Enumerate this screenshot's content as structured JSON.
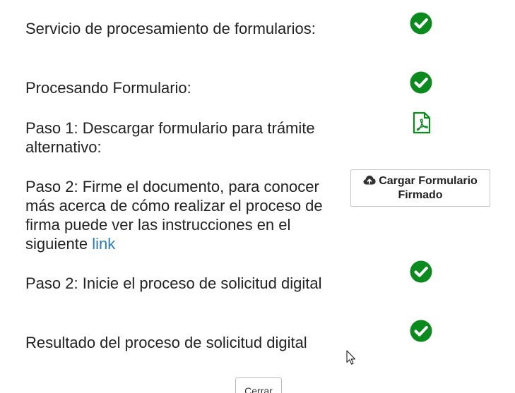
{
  "steps": [
    {
      "label": "Servicio de procesamiento de formularios:",
      "status_icon": "check-circle-icon"
    },
    {
      "label": "Procesando Formulario:",
      "status_icon": "check-circle-icon"
    },
    {
      "label": "Paso 1: Descargar formulario para trámite alternativo:",
      "status_icon": "pdf-file-icon"
    },
    {
      "label_prefix": "Paso 2: Firme el documento, para conocer más acerca de cómo realizar el proceso de firma puede ver las instrucciones en el siguiente ",
      "link_text": "link",
      "action_icon": "cloud-upload-icon",
      "button_label": "Cargar Formulario Firmado"
    },
    {
      "label": "Paso 2: Inicie el proceso de solicitud digital",
      "status_icon": "check-circle-icon"
    },
    {
      "label": "Resultado del proceso de solicitud digital",
      "status_icon": "check-circle-icon"
    }
  ],
  "close_button": {
    "label": "Cerrar"
  },
  "colors": {
    "success": "#0b8a1e",
    "link": "#2a7ab8",
    "text": "#222222"
  }
}
